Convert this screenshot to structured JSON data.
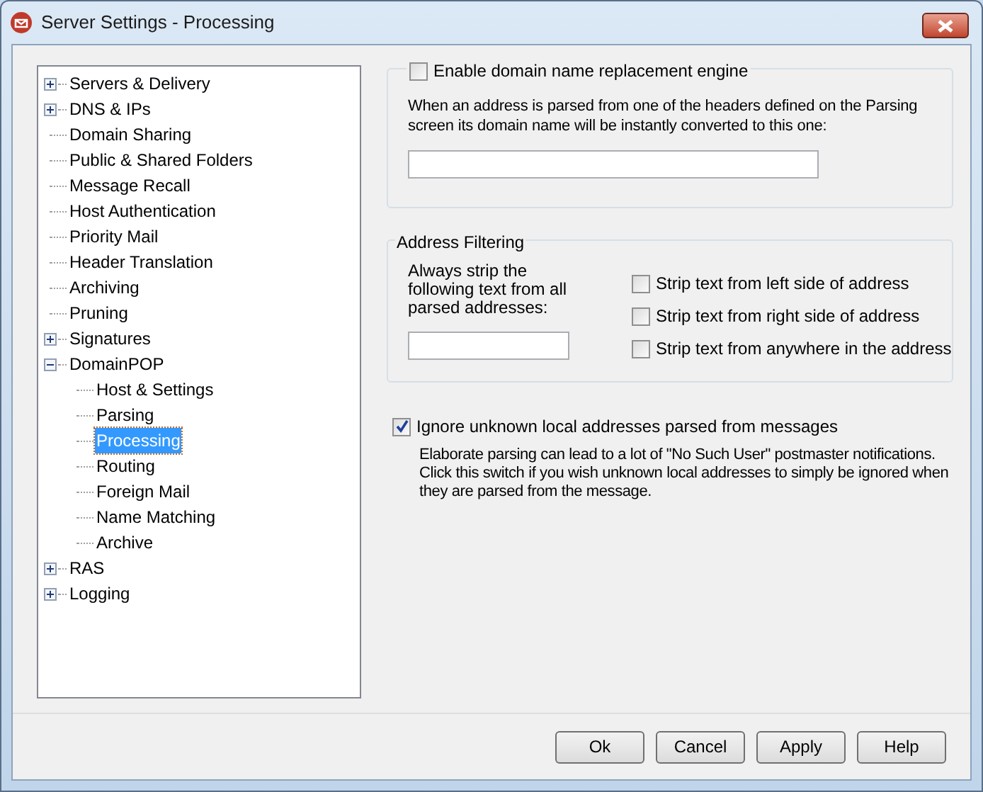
{
  "window": {
    "title": "Server Settings - Processing"
  },
  "tree": [
    {
      "label": "Servers & Delivery",
      "expanded": false,
      "selected": false
    },
    {
      "label": "DNS & IPs",
      "expanded": false,
      "selected": false
    },
    {
      "label": "Domain Sharing",
      "selected": false
    },
    {
      "label": "Public & Shared Folders",
      "selected": false
    },
    {
      "label": "Message Recall",
      "selected": false
    },
    {
      "label": "Host Authentication",
      "selected": false
    },
    {
      "label": "Priority Mail",
      "selected": false
    },
    {
      "label": "Header Translation",
      "selected": false
    },
    {
      "label": "Archiving",
      "selected": false
    },
    {
      "label": "Pruning",
      "selected": false
    },
    {
      "label": "Signatures",
      "expanded": false,
      "selected": false
    },
    {
      "label": "DomainPOP",
      "expanded": true,
      "selected": false,
      "children": [
        {
          "label": "Host & Settings",
          "selected": false
        },
        {
          "label": "Parsing",
          "selected": false
        },
        {
          "label": "Processing",
          "selected": true
        },
        {
          "label": "Routing",
          "selected": false
        },
        {
          "label": "Foreign Mail",
          "selected": false
        },
        {
          "label": "Name Matching",
          "selected": false
        },
        {
          "label": "Archive",
          "selected": false
        }
      ]
    },
    {
      "label": "RAS",
      "expanded": false,
      "selected": false
    },
    {
      "label": "Logging",
      "expanded": false,
      "selected": false
    }
  ],
  "domain_replacement": {
    "label": "Enable domain name replacement engine",
    "checked": false,
    "description": "When an address is parsed from one of the headers defined on the Parsing screen its domain name will be instantly converted to this one:"
  },
  "address_filtering": {
    "title": "Address Filtering",
    "label": "Always strip the following text from all parsed addresses:",
    "options": [
      {
        "label": "Strip text from left side of address",
        "checked": false
      },
      {
        "label": "Strip text from right side of address",
        "checked": false
      },
      {
        "label": "Strip text from anywhere in the address",
        "checked": false
      }
    ]
  },
  "ignore_unknown": {
    "label": "Ignore unknown local addresses parsed from messages",
    "checked": true,
    "description": "Elaborate parsing can lead to a lot of \"No Such User\" postmaster notifications. Click this switch if you wish unknown local addresses to simply be ignored when they are parsed from the message."
  },
  "buttons": [
    "Ok",
    "Cancel",
    "Apply",
    "Help"
  ]
}
